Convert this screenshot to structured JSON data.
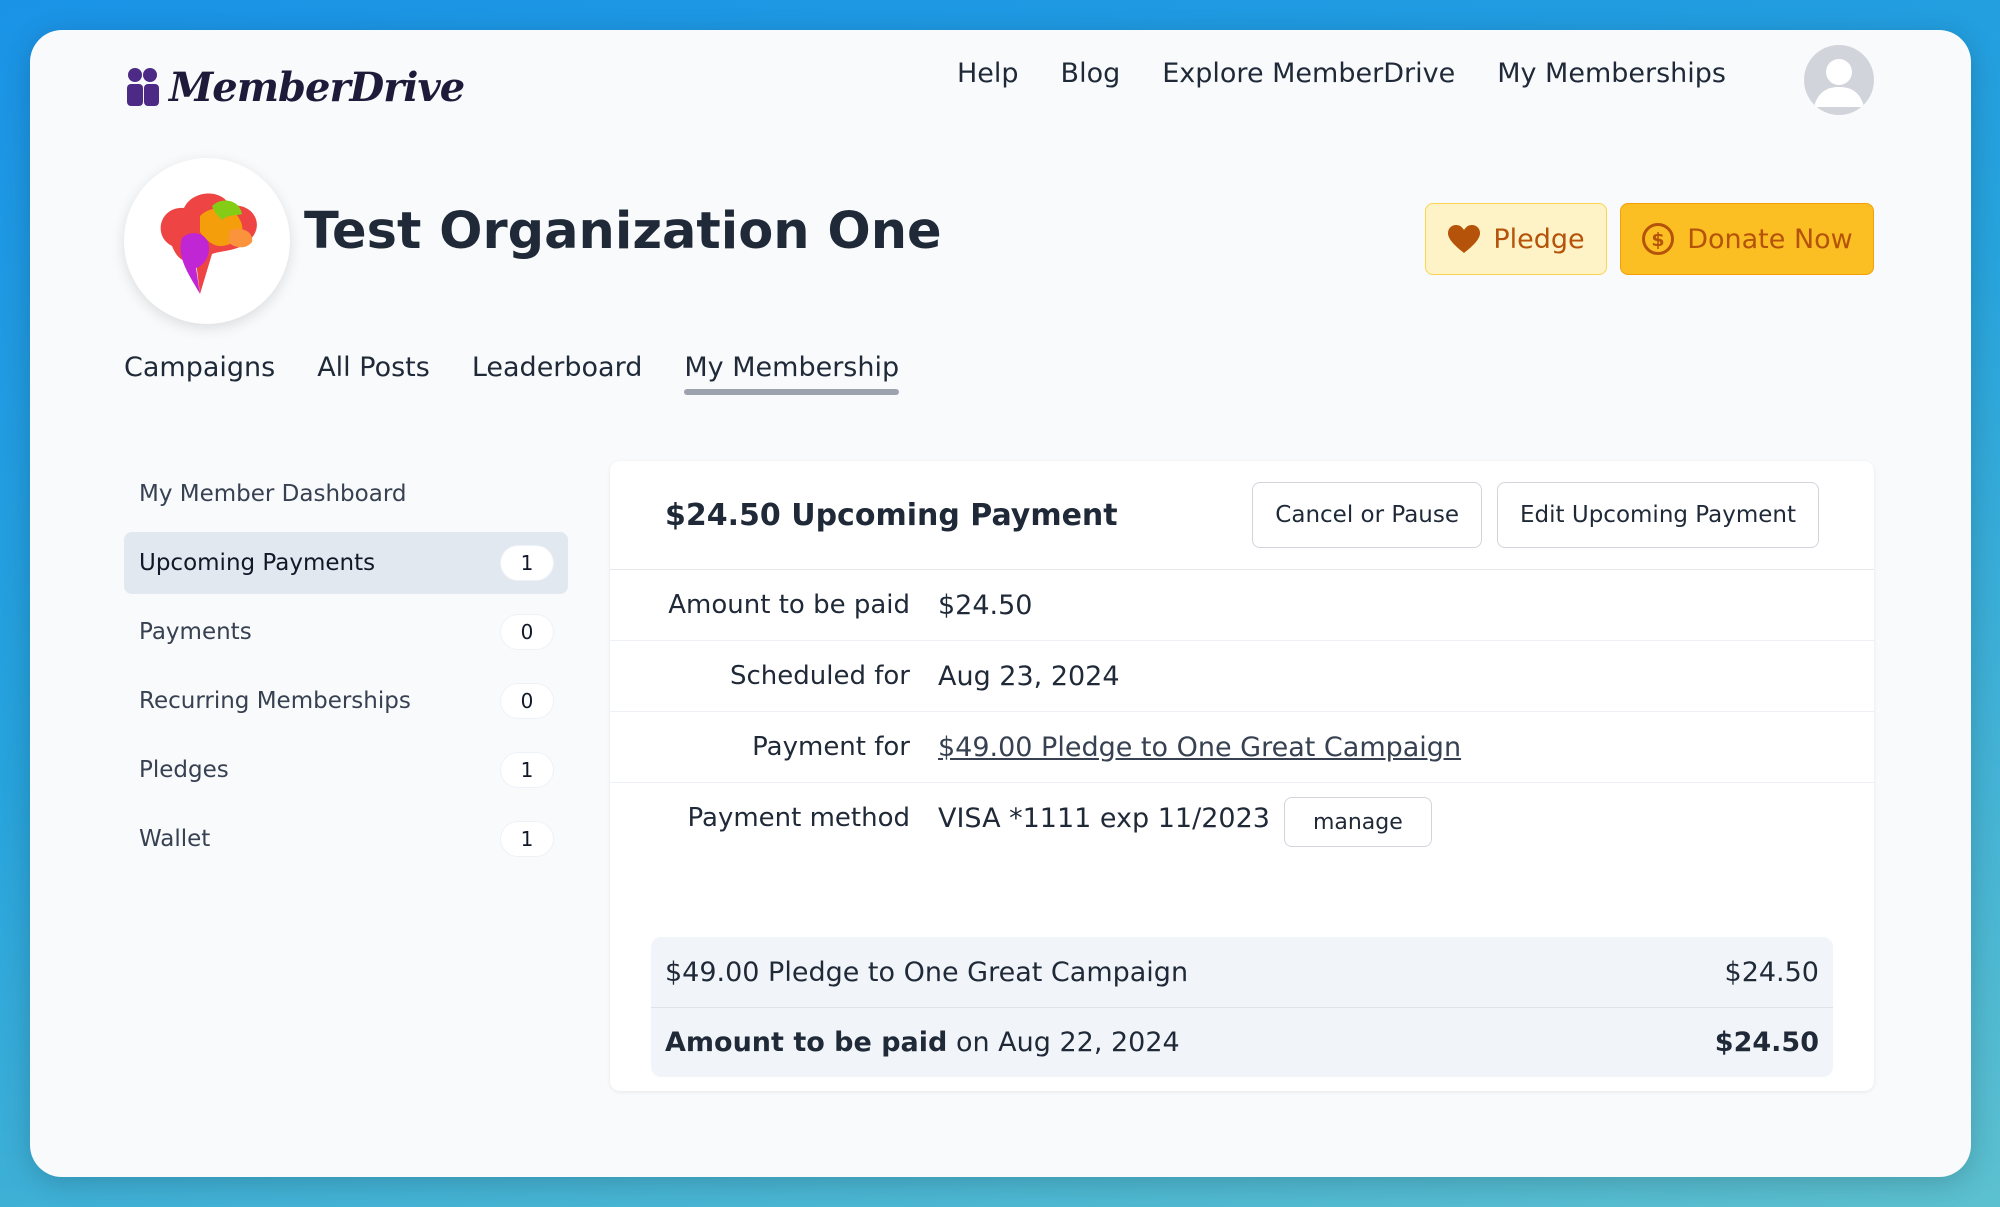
{
  "app": {
    "logo_text": "MemberDrive"
  },
  "topnav": {
    "help": "Help",
    "blog": "Blog",
    "explore": "Explore MemberDrive",
    "memberships": "My Memberships"
  },
  "org": {
    "title": "Test Organization One"
  },
  "actions": {
    "pledge": "Pledge",
    "donate": "Donate Now"
  },
  "tabs": [
    {
      "label": "Campaigns"
    },
    {
      "label": "All Posts"
    },
    {
      "label": "Leaderboard"
    },
    {
      "label": "My Membership",
      "active": true
    }
  ],
  "sidebar": {
    "items": [
      {
        "label": "My Member Dashboard"
      },
      {
        "label": "Upcoming Payments",
        "count": "1",
        "active": true
      },
      {
        "label": "Payments",
        "count": "0"
      },
      {
        "label": "Recurring Memberships",
        "count": "0"
      },
      {
        "label": "Pledges",
        "count": "1"
      },
      {
        "label": "Wallet",
        "count": "1"
      }
    ]
  },
  "card": {
    "title": "$24.50 Upcoming Payment",
    "cancel_label": "Cancel or Pause",
    "edit_label": "Edit Upcoming Payment",
    "details": {
      "amount_label": "Amount to be paid",
      "amount_value": "$24.50",
      "scheduled_label": "Scheduled for",
      "scheduled_value": "Aug 23, 2024",
      "payment_for_label": "Payment for",
      "payment_for_value": "$49.00 Pledge to One Great Campaign",
      "method_label": "Payment method",
      "method_value": "VISA *1111 exp 11/2023",
      "manage_label": "manage"
    },
    "summary": {
      "line_label": "$49.00 Pledge to One Great Campaign",
      "line_amount": "$24.50",
      "total_label_bold": "Amount to be paid",
      "total_label_rest": "on Aug 22, 2024",
      "total_amount": "$24.50"
    }
  },
  "colors": {
    "accent_yellow": "#fbbf24",
    "pledge_bg": "#fef3c7",
    "brand_text": "#b45309"
  }
}
